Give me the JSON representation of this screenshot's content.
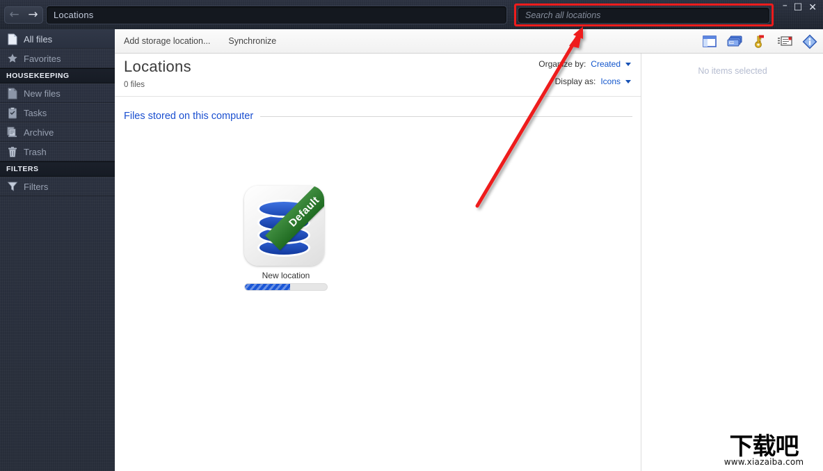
{
  "window": {
    "path_value": "Locations",
    "back_icon": "arrow-left-icon",
    "forward_icon": "arrow-right-icon",
    "minimize_label": "–",
    "maximize_label": "☐",
    "close_label": "✕"
  },
  "search": {
    "placeholder": "Search all locations",
    "value": "",
    "highlight_color": "#ee1c1c"
  },
  "sidebar": {
    "items": [
      {
        "label": "All files",
        "icon": "file-icon",
        "active": true,
        "type": "item"
      },
      {
        "label": "Favorites",
        "icon": "star-icon",
        "active": false,
        "type": "item"
      },
      {
        "label": "HOUSEKEEPING",
        "icon": "",
        "active": false,
        "type": "header"
      },
      {
        "label": "New files",
        "icon": "new-file-icon",
        "active": false,
        "type": "item"
      },
      {
        "label": "Tasks",
        "icon": "clipboard-icon",
        "active": false,
        "type": "item"
      },
      {
        "label": "Archive",
        "icon": "archive-icon",
        "active": false,
        "type": "item"
      },
      {
        "label": "Trash",
        "icon": "trash-icon",
        "active": false,
        "type": "item"
      },
      {
        "label": "FILTERS",
        "icon": "",
        "active": false,
        "type": "header"
      },
      {
        "label": "Filters",
        "icon": "funnel-icon",
        "active": false,
        "type": "item"
      }
    ]
  },
  "toolbar": {
    "buttons": [
      {
        "label": "Add storage location..."
      },
      {
        "label": "Synchronize"
      }
    ],
    "icons": [
      {
        "name": "panel-layout-icon"
      },
      {
        "name": "cards-icon"
      },
      {
        "name": "key-icon"
      },
      {
        "name": "details-list-icon"
      },
      {
        "name": "info-icon"
      }
    ]
  },
  "content": {
    "title": "Locations",
    "file_count": "0 files",
    "organize_by_label": "Organize by:",
    "organize_by_value": "Created",
    "display_as_label": "Display as:",
    "display_as_value": "Icons",
    "group_label": "Files stored on this computer",
    "link_color": "#1a4fd0",
    "item": {
      "name": "New location",
      "badge": "Default",
      "badge_color": "#2b7a2b",
      "icon": "database-icon",
      "progress_percent": 55
    }
  },
  "detail_panel": {
    "message": "No items selected"
  },
  "watermark": {
    "text_cn": "下载吧",
    "url": "www.xiazaiba.com"
  }
}
